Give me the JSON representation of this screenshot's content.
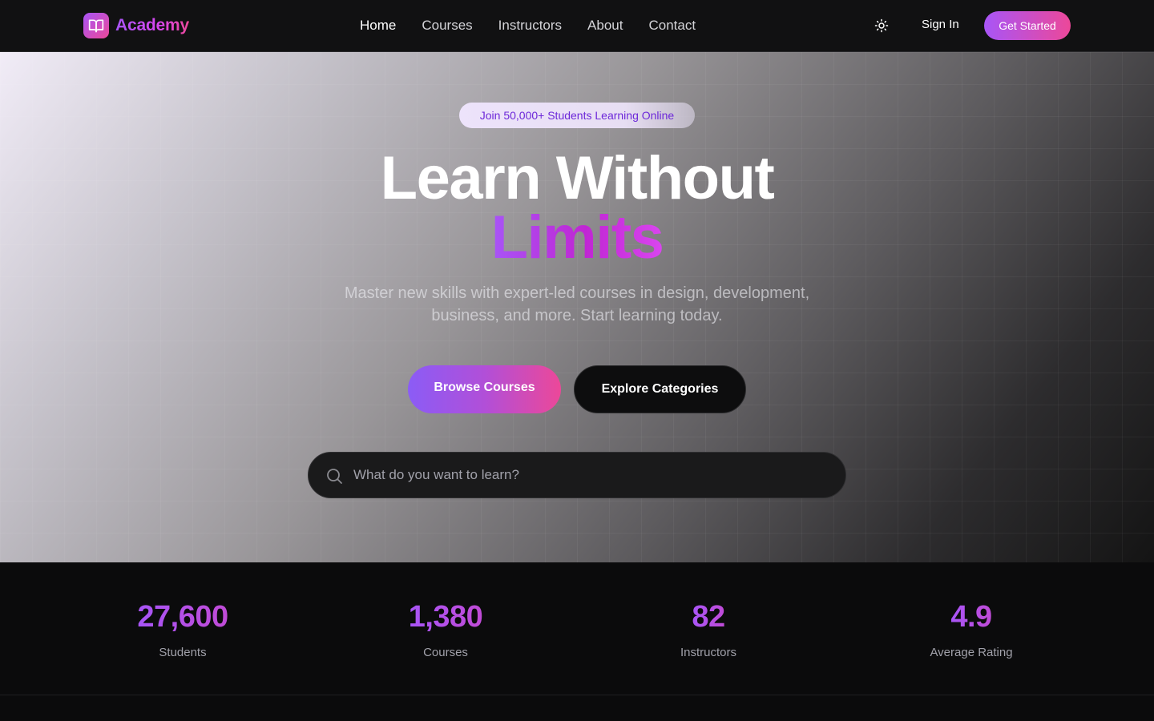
{
  "nav": {
    "brand": "Academy",
    "links": [
      {
        "label": "Home",
        "active": true
      },
      {
        "label": "Courses",
        "active": false
      },
      {
        "label": "Instructors",
        "active": false
      },
      {
        "label": "About",
        "active": false
      },
      {
        "label": "Contact",
        "active": false
      }
    ],
    "theme_icon": "sun-icon",
    "sign_in": "Sign In",
    "get_started": "Get Started"
  },
  "hero": {
    "badge": "Join 50,000+ Students Learning Online",
    "title_line1": "Learn Without",
    "title_line2": "Limits",
    "subtitle": "Master new skills with expert-led courses in design, development, business, and more. Start learning today.",
    "primary_cta": "Browse Courses",
    "secondary_cta": "Explore Categories",
    "search": {
      "placeholder": "What do you want to learn?",
      "value": ""
    }
  },
  "stats": [
    {
      "value": "27,600",
      "label": "Students"
    },
    {
      "value": "1,380",
      "label": "Courses"
    },
    {
      "value": "82",
      "label": "Instructors"
    },
    {
      "value": "4.9",
      "label": "Average Rating"
    }
  ],
  "colors": {
    "accent_purple": "#a855f7",
    "accent_pink": "#ec4899",
    "nav_bg": "#111112",
    "page_bg": "#0b0b0c"
  }
}
